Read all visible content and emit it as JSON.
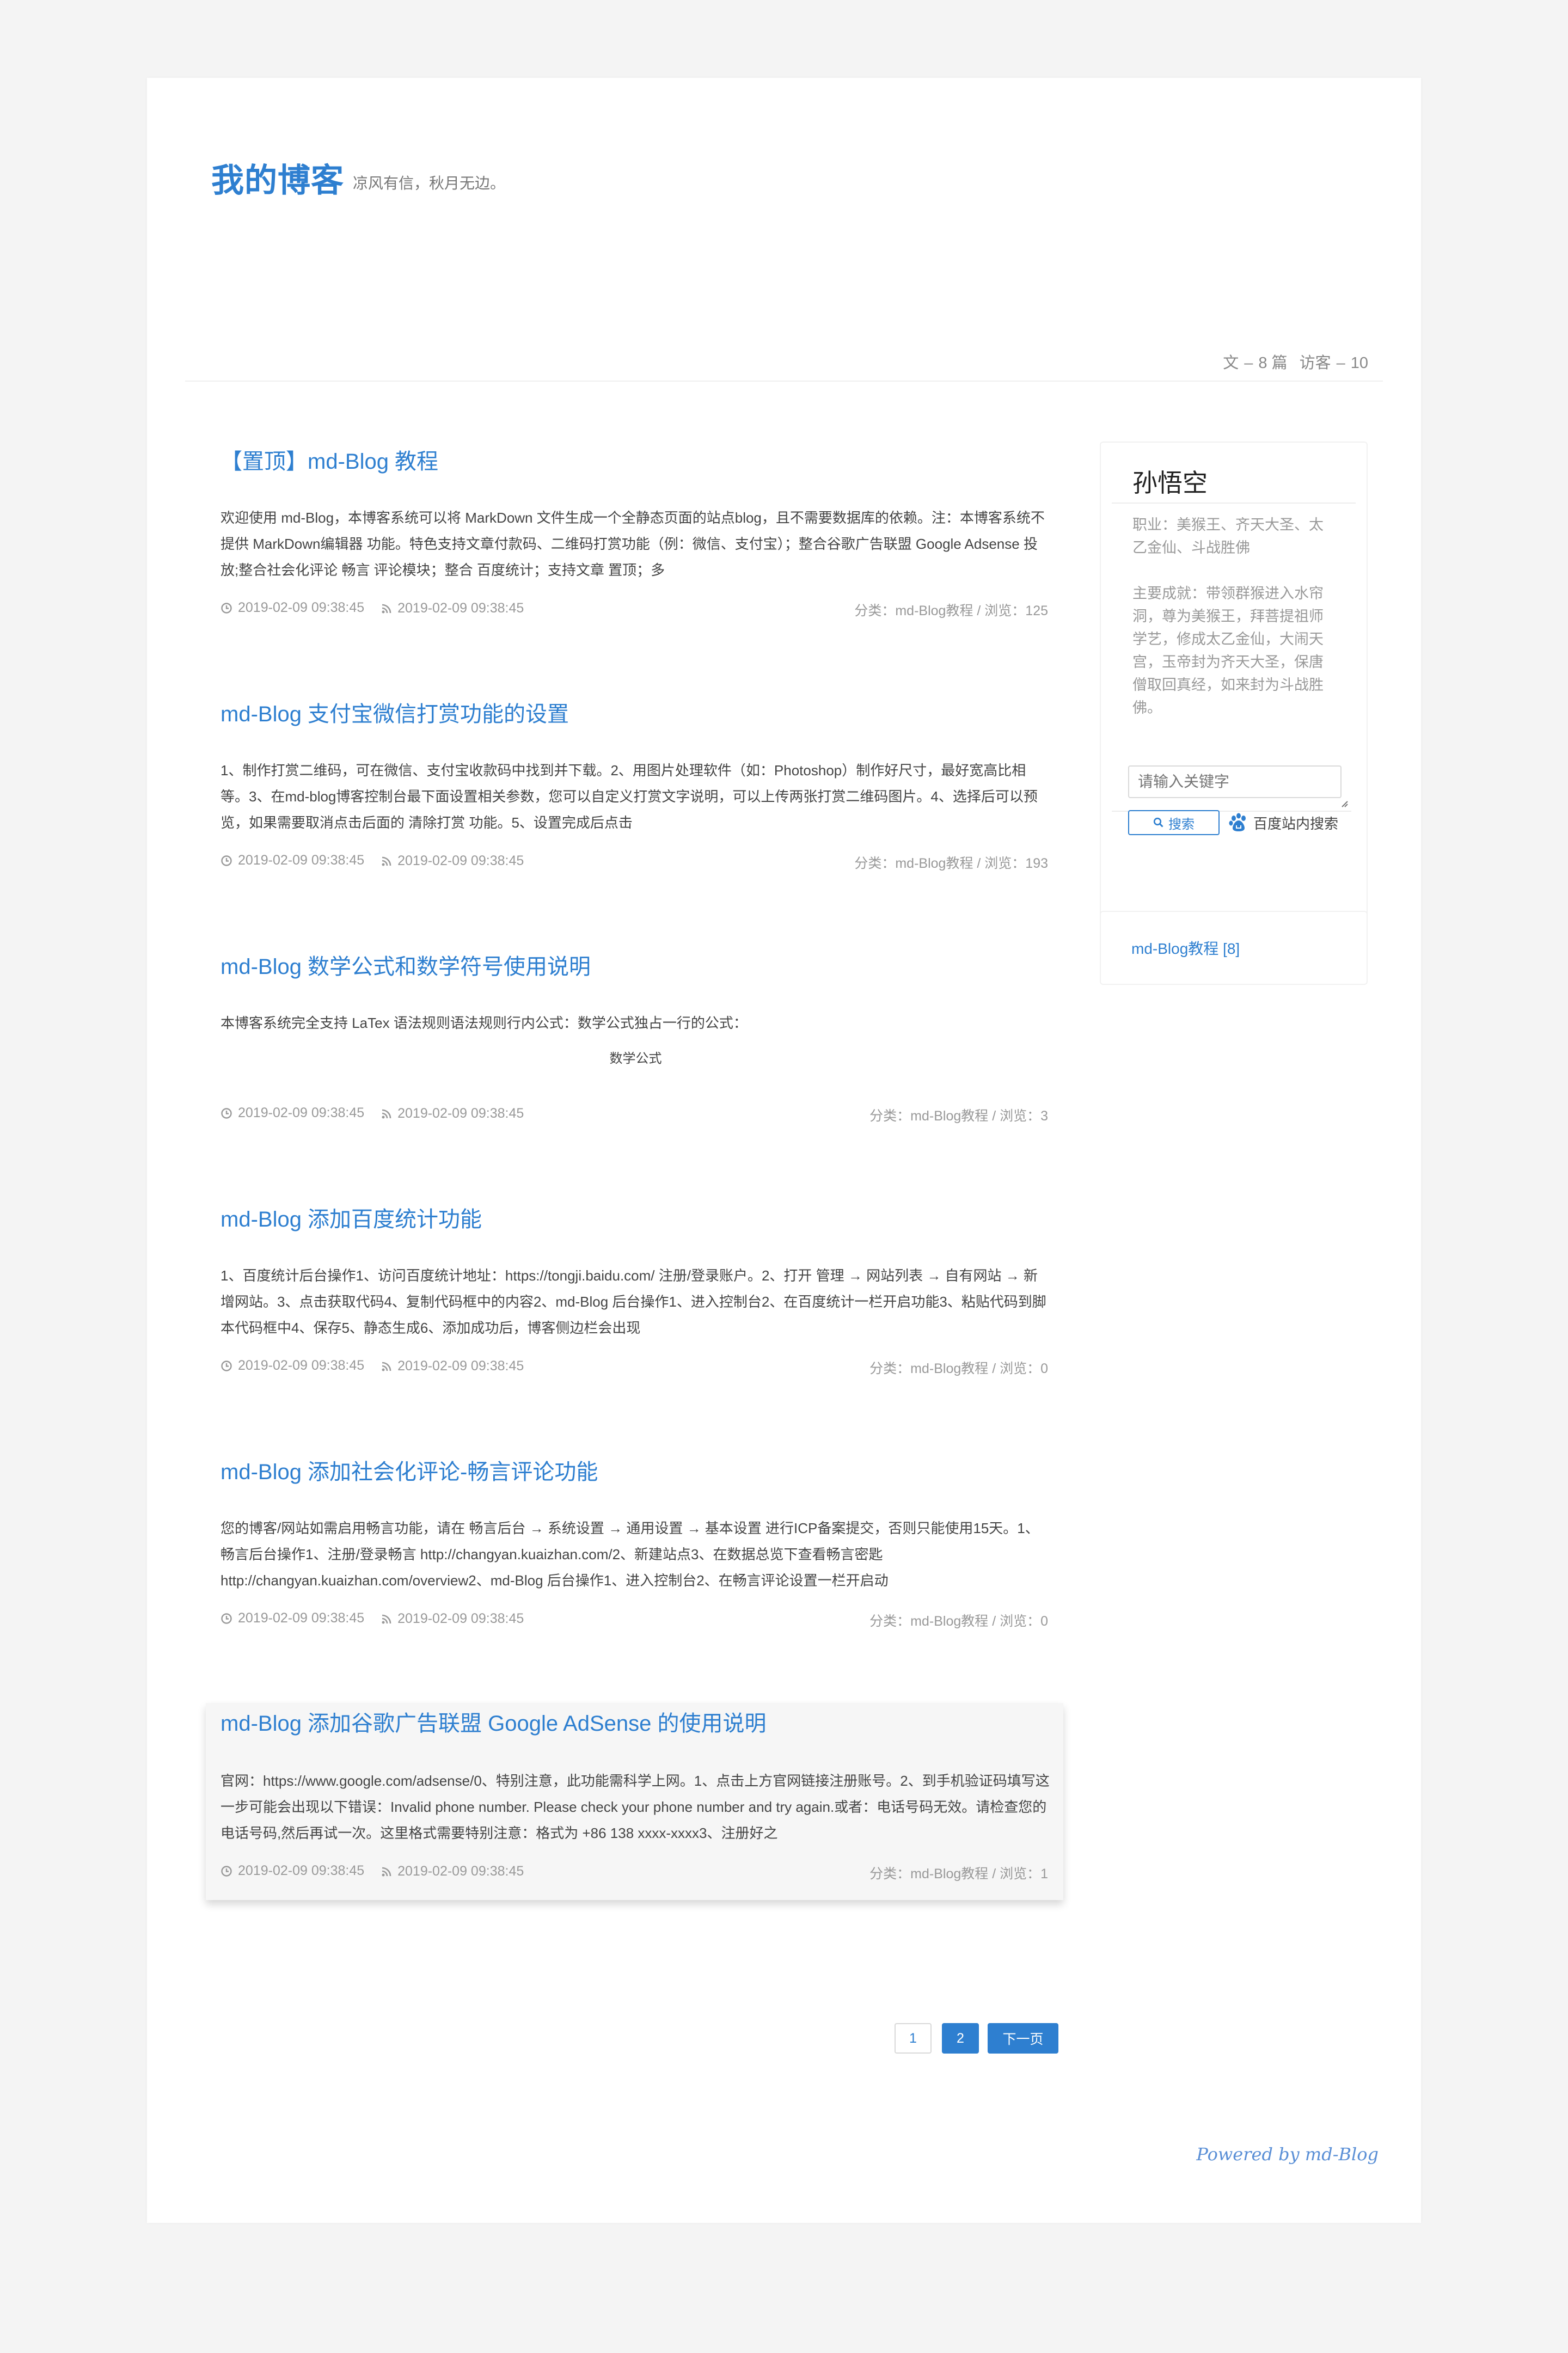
{
  "header": {
    "site_title": "我的博客",
    "site_subtitle": "凉风有信，秋月无边。",
    "stats": {
      "articles_label": "文",
      "articles_count": "8",
      "articles_unit": "篇",
      "visitors_label": "访客",
      "visitors_count": "10"
    }
  },
  "posts": [
    {
      "title": "【置顶】md-Blog 教程",
      "excerpt": "欢迎使用 md-Blog，本博客系统可以将 MarkDown 文件生成一个全静态页面的站点blog，且不需要数据库的依赖。注：本博客系统不提供 MarkDown编辑器 功能。特色支持文章付款码、二维码打赏功能（例：微信、支付宝）；整合谷歌广告联盟 Google Adsense 投放;整合社会化评论 畅言 评论模块；整合 百度统计；支持文章 置顶；多",
      "created": "2019-02-09 09:38:45",
      "updated": "2019-02-09 09:38:45",
      "category_meta": "分类：md-Blog教程 / 浏览：125"
    },
    {
      "title": "md-Blog 支付宝微信打赏功能的设置",
      "excerpt": "1、制作打赏二维码，可在微信、支付宝收款码中找到并下载。2、用图片处理软件（如：Photoshop）制作好尺寸，最好宽高比相等。3、在md-blog博客控制台最下面设置相关参数，您可以自定义打赏文字说明，可以上传两张打赏二维码图片。4、选择后可以预览，如果需要取消点击后面的 清除打赏 功能。5、设置完成后点击",
      "created": "2019-02-09 09:38:45",
      "updated": "2019-02-09 09:38:45",
      "category_meta": "分类：md-Blog教程 / 浏览：193"
    },
    {
      "title": "md-Blog 数学公式和数学符号使用说明",
      "excerpt": "本博客系统完全支持 LaTex 语法规则语法规则行内公式：数学公式独占一行的公式：",
      "formula": "数学公式",
      "created": "2019-02-09 09:38:45",
      "updated": "2019-02-09 09:38:45",
      "category_meta": "分类：md-Blog教程 / 浏览：3"
    },
    {
      "title": "md-Blog 添加百度统计功能",
      "excerpt": "1、百度统计后台操作1、访问百度统计地址：https://tongji.baidu.com/ 注册/登录账户。2、打开 管理 → 网站列表 → 自有网站 → 新增网站。3、点击获取代码4、复制代码框中的内容2、md-Blog 后台操作1、进入控制台2、在百度统计一栏开启功能3、粘贴代码到脚本代码框中4、保存5、静态生成6、添加成功后，博客侧边栏会出现",
      "created": "2019-02-09 09:38:45",
      "updated": "2019-02-09 09:38:45",
      "category_meta": "分类：md-Blog教程 / 浏览：0"
    },
    {
      "title": "md-Blog 添加社会化评论-畅言评论功能",
      "excerpt": "您的博客/网站如需启用畅言功能，请在 畅言后台 → 系统设置 → 通用设置 → 基本设置 进行ICP备案提交，否则只能使用15天。1、畅言后台操作1、注册/登录畅言 http://changyan.kuaizhan.com/2、新建站点3、在数据总览下查看畅言密匙http://changyan.kuaizhan.com/overview2、md-Blog 后台操作1、进入控制台2、在畅言评论设置一栏开启动",
      "created": "2019-02-09 09:38:45",
      "updated": "2019-02-09 09:38:45",
      "category_meta": "分类：md-Blog教程 / 浏览：0"
    },
    {
      "title": "md-Blog 添加谷歌广告联盟 Google AdSense 的使用说明",
      "excerpt": "官网：https://www.google.com/adsense/0、特别注意，此功能需科学上网。1、点击上方官网链接注册账号。2、到手机验证码填写这一步可能会出现以下错误：Invalid phone number. Please check your phone number and try again.或者：电话号码无效。请检查您的电话号码,然后再试一次。这里格式需要特别注意：格式为 +86 138 xxxx-xxxx3、注册好之",
      "created": "2019-02-09 09:38:45",
      "updated": "2019-02-09 09:38:45",
      "category_meta": "分类：md-Blog教程 / 浏览：1"
    }
  ],
  "sidebar": {
    "profile_name": "孙悟空",
    "bio_occupation": "职业：美猴王、齐天大圣、太乙金仙、斗战胜佛",
    "bio_achievements": "主要成就：带领群猴进入水帘洞，尊为美猴王，拜菩提祖师学艺，修成太乙金仙，大闹天宫，玉帝封为齐天大圣，保唐僧取回真经，如来封为斗战胜佛。",
    "search_placeholder": "请输入关键字",
    "search_button": "搜索",
    "baidu_search_label": "百度站内搜索",
    "category_link": "md-Blog教程 [8]"
  },
  "pagination": {
    "page_1": "1",
    "page_2": "2",
    "next_label": "下一页"
  },
  "footer": {
    "powered_by": "Powered by md-Blog"
  },
  "colors": {
    "accent": "#2e7fd0",
    "page_background": "#f4f4f4",
    "card_background": "#ffffff"
  }
}
